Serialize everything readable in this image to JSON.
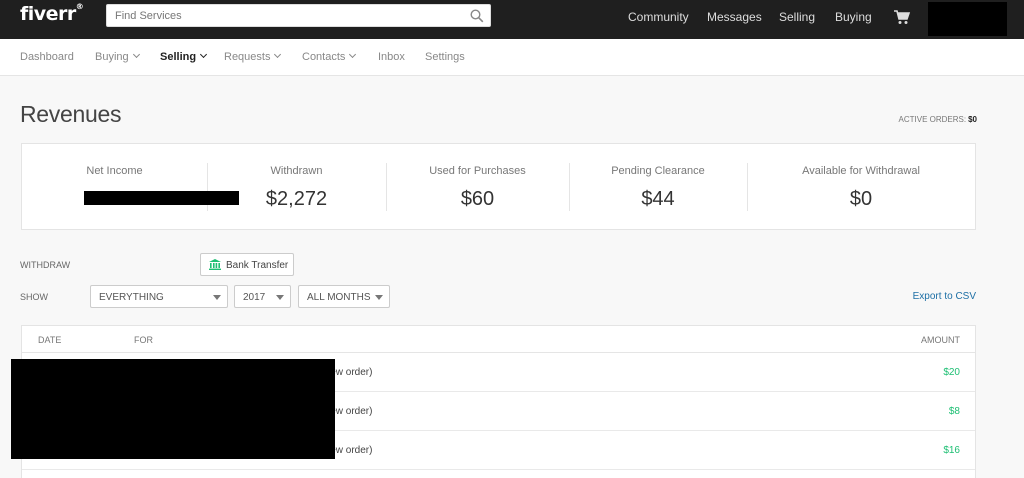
{
  "header": {
    "logo": "fiverr",
    "logo_mark": "®",
    "search_placeholder": "Find Services",
    "nav": [
      "Community",
      "Messages",
      "Selling",
      "Buying"
    ]
  },
  "subnav": {
    "items": [
      {
        "label": "Dashboard",
        "dropdown": false,
        "active": false
      },
      {
        "label": "Buying",
        "dropdown": true,
        "active": false
      },
      {
        "label": "Selling",
        "dropdown": true,
        "active": true
      },
      {
        "label": "Requests",
        "dropdown": true,
        "active": false
      },
      {
        "label": "Contacts",
        "dropdown": true,
        "active": false
      },
      {
        "label": "Inbox",
        "dropdown": false,
        "active": false
      },
      {
        "label": "Settings",
        "dropdown": false,
        "active": false
      }
    ]
  },
  "page": {
    "title": "Revenues",
    "active_orders_label": "ACTIVE ORDERS:",
    "active_orders_value": "$0"
  },
  "stats": [
    {
      "label": "Net Income",
      "value": ""
    },
    {
      "label": "Withdrawn",
      "value": "$2,272"
    },
    {
      "label": "Used for Purchases",
      "value": "$60"
    },
    {
      "label": "Pending Clearance",
      "value": "$44"
    },
    {
      "label": "Available for Withdrawal",
      "value": "$0"
    }
  ],
  "filters": {
    "withdraw_label": "WITHDRAW",
    "bank_transfer": "Bank Transfer",
    "show_label": "SHOW",
    "type_selected": "EVERYTHING",
    "year_selected": "2017",
    "month_selected": "ALL MONTHS",
    "export": "Export to CSV"
  },
  "table": {
    "columns": [
      "DATE",
      "FOR",
      "AMOUNT"
    ],
    "rows": [
      {
        "for": "iew order)",
        "amount": "$20"
      },
      {
        "for": "iew order)",
        "amount": "$8"
      },
      {
        "for": "iew order)",
        "amount": "$16"
      }
    ]
  },
  "colors": {
    "header_bg": "#1f1f1f",
    "amount_green": "#1dbf73",
    "link_blue": "#1d6fa5",
    "bank_icon_green": "#1dbf73"
  }
}
